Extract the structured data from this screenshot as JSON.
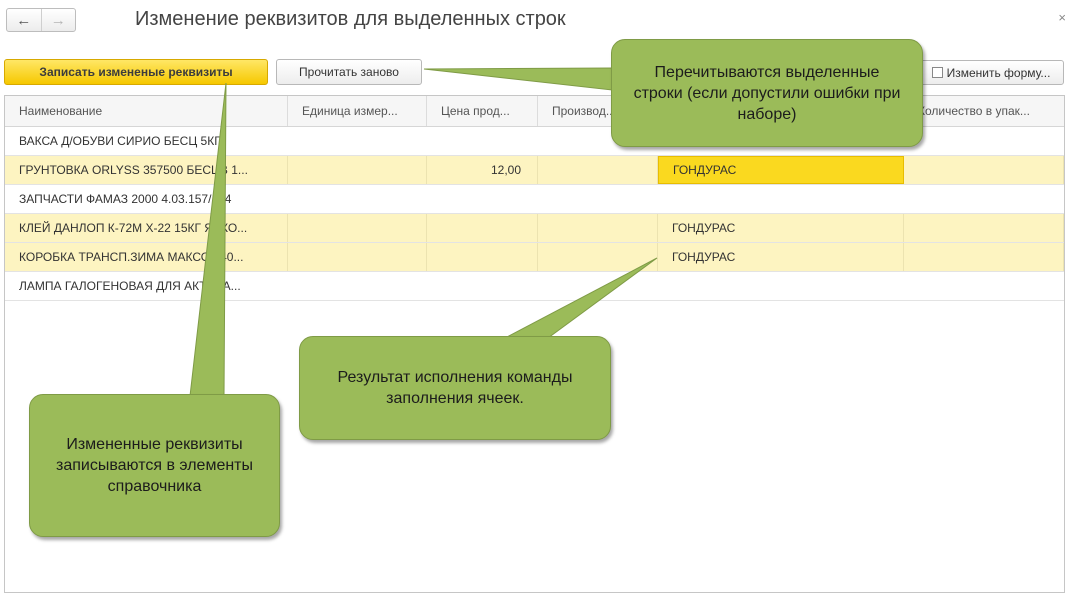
{
  "window": {
    "title": "Изменение реквизитов для выделенных строк"
  },
  "toolbar": {
    "save_label": "Записать измененые реквизиты",
    "reload_label": "Прочитать заново",
    "change_form_label": "Изменить форму..."
  },
  "table": {
    "columns": [
      "Наименование",
      "Единица измер...",
      "Цена прод...",
      "Производ...",
      "",
      "Количество в упак..."
    ],
    "rows": [
      {
        "name": "ВАКСА Д/ОБУВИ СИРИО БЕСЦ 5КГ",
        "unit": "",
        "price": "",
        "producer": "",
        "country": "",
        "qty": "",
        "highlight": false
      },
      {
        "name": "ГРУНТОВКА ORLYSS 357500 БЕСЦВ 1...",
        "unit": "",
        "price": "12,00",
        "producer": "",
        "country": "ГОНДУРАС",
        "qty": "",
        "highlight": true
      },
      {
        "name": "ЗАПЧАСТИ ФАМАЗ 2000 4.03.157/134",
        "unit": "",
        "price": "",
        "producer": "",
        "country": "",
        "qty": "",
        "highlight": false
      },
      {
        "name": "КЛЕЙ ДАНЛОП К-72М Х-22 15КГ ЯРКО...",
        "unit": "",
        "price": "",
        "producer": "",
        "country": "ГОНДУРАС",
        "qty": "",
        "highlight": true
      },
      {
        "name": "КОРОБКА ТРАНСП.ЗИМА МАКСО 540...",
        "unit": "",
        "price": "",
        "producer": "",
        "country": "ГОНДУРАС",
        "qty": "",
        "highlight": true
      },
      {
        "name": "ЛАМПА ГАЛОГЕНОВАЯ ДЛЯ АКТИВА...",
        "unit": "",
        "price": "",
        "producer": "",
        "country": "",
        "qty": "",
        "highlight": false
      }
    ]
  },
  "callouts": {
    "reload": "Перечитываются выделенные строки (если допустили ошибки при наборе)",
    "result": "Результат исполнения команды заполнения ячеек.",
    "save": "Измененные реквизиты записываются в элементы справочника"
  },
  "colors": {
    "accent": "#f6c800",
    "row_highlight": "#fdf4c1",
    "selected_cell": "#fad91f",
    "callout": "#9bbb59"
  }
}
